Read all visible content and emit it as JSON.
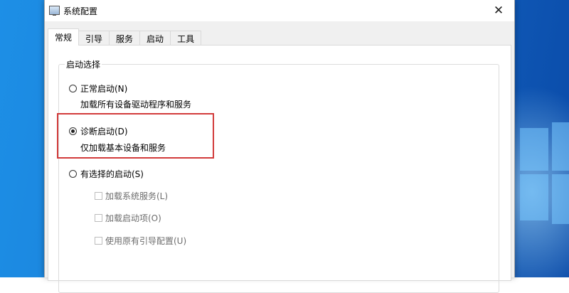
{
  "window": {
    "title": "系统配置",
    "close_glyph": "✕"
  },
  "tabs": [
    {
      "label": "常规",
      "active": true
    },
    {
      "label": "引导",
      "active": false
    },
    {
      "label": "服务",
      "active": false
    },
    {
      "label": "启动",
      "active": false
    },
    {
      "label": "工具",
      "active": false
    }
  ],
  "startup_selection": {
    "legend": "启动选择",
    "normal": {
      "label": "正常启动(N)",
      "description": "加载所有设备驱动程序和服务",
      "selected": false
    },
    "diagnostic": {
      "label": "诊断启动(D)",
      "description": "仅加载基本设备和服务",
      "selected": true
    },
    "selective": {
      "label": "有选择的启动(S)",
      "selected": false,
      "options": [
        {
          "label": "加载系统服务(L)",
          "checked": false,
          "enabled": false
        },
        {
          "label": "加载启动项(O)",
          "checked": false,
          "enabled": false
        },
        {
          "label": "使用原有引导配置(U)",
          "checked": false,
          "enabled": false
        }
      ]
    }
  },
  "colors": {
    "highlight_border": "#d23b3b",
    "wallpaper_blue": "#1a7fd8",
    "dialog_background": "#f0f0f0"
  },
  "icons": {
    "app": "msconfig-icon",
    "close": "close-icon"
  }
}
